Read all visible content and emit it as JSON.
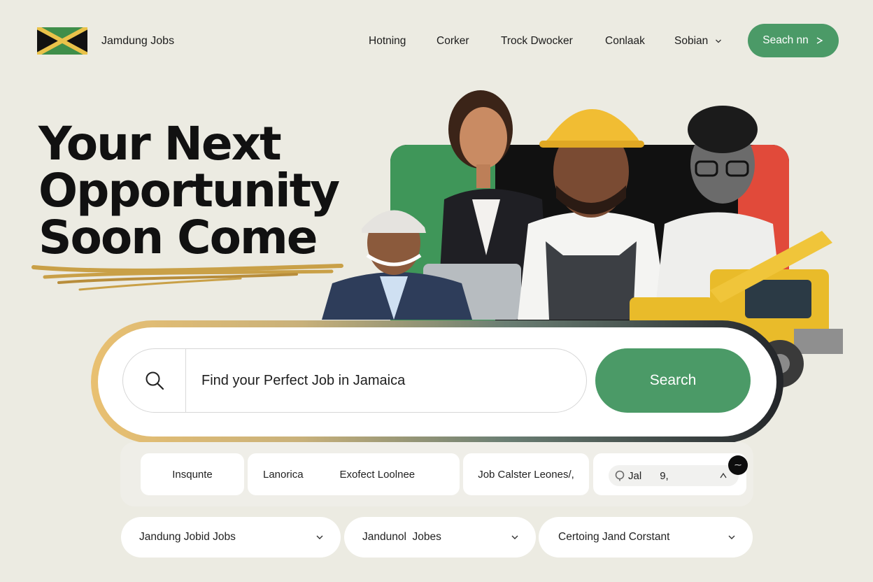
{
  "brand": {
    "name": "Jamdung Jobs",
    "flag_icon": "jamaica-flag-icon"
  },
  "nav": {
    "items": [
      "Hotning",
      "Corker",
      "Trock Dwocker",
      "Conlaak",
      "Sobian"
    ],
    "cta_label": "Seach nn"
  },
  "hero": {
    "headline": [
      "Your Next",
      "Opportunity",
      "Soon Come"
    ]
  },
  "search": {
    "placeholder": "Find your Perfect Job in Jamaica",
    "button_label": "Search"
  },
  "filters": {
    "chip1": "Insqunte",
    "chip2a": "Lanorica",
    "chip2b": "Exofect Loolnee",
    "chip3": "Job Calster Leones/,",
    "location_value": "Jal",
    "location_extra": "9,"
  },
  "dropdowns": [
    "Jandung Jobid Jobs",
    "Jandunol  Jobes",
    "Certoing Jand Corstant"
  ],
  "colors": {
    "accent_green": "#4b9a67",
    "background": "#ecebe2",
    "flag_green": "#3f8e4a",
    "flag_gold": "#e9c24a",
    "flag_black": "#111111",
    "hero_red": "#e14a3a"
  }
}
